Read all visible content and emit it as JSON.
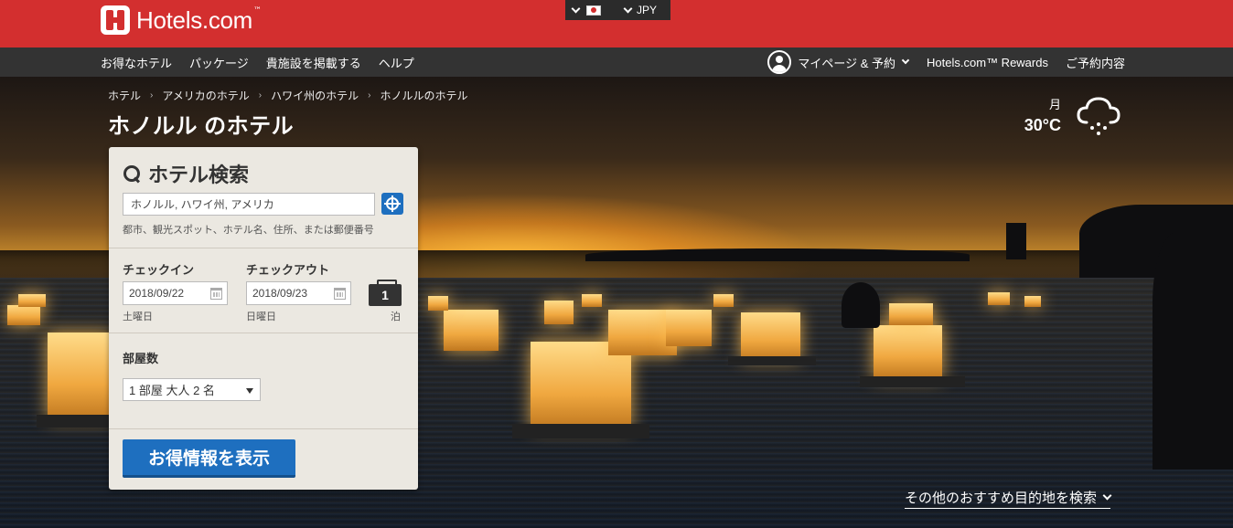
{
  "brand": {
    "name": "Hotels.com",
    "tm": "™"
  },
  "locale": {
    "currency": "JPY"
  },
  "nav": {
    "left": [
      "お得なホテル",
      "パッケージ",
      "貴施設を掲載する",
      "ヘルプ"
    ],
    "account": "マイページ & 予約",
    "rewards": "Hotels.com™ Rewards",
    "bookings": "ご予約内容"
  },
  "breadcrumb": [
    "ホテル",
    "アメリカのホテル",
    "ハワイ州のホテル",
    "ホノルルのホテル"
  ],
  "page_title": "ホノルル のホテル",
  "weather": {
    "day": "月",
    "temp": "30°C"
  },
  "search": {
    "title": "ホテル検索",
    "destination_value": "ホノルル, ハワイ州, アメリカ",
    "destination_hint": "都市、観光スポット、ホテル名、住所、または郵便番号",
    "checkin_label": "チェックイン",
    "checkin_value": "2018/09/22",
    "checkin_weekday": "土曜日",
    "checkout_label": "チェックアウト",
    "checkout_value": "2018/09/23",
    "checkout_weekday": "日曜日",
    "nights": "1",
    "nights_unit": "泊",
    "rooms_label": "部屋数",
    "rooms_value": "1 部屋 大人 2 名",
    "submit": "お得情報を表示"
  },
  "more_destinations": "その他のおすすめ目的地を検索"
}
